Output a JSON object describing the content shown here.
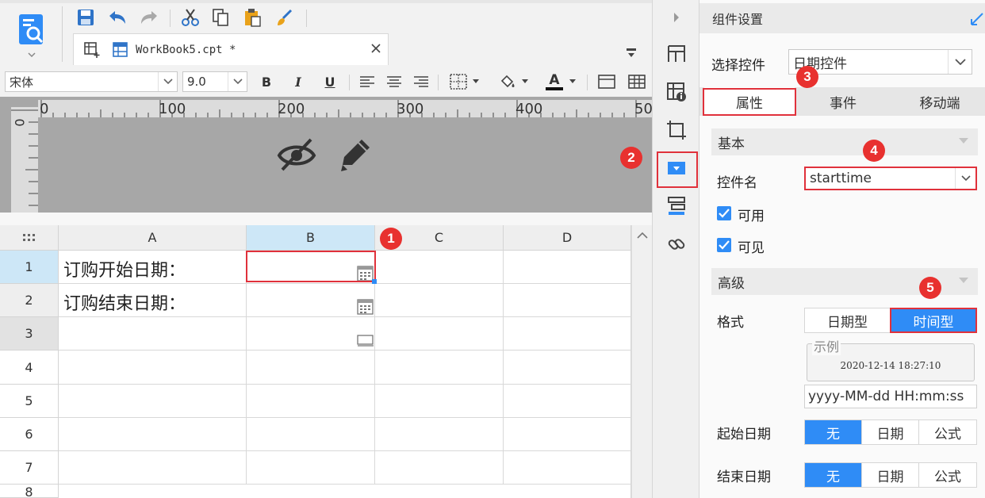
{
  "tab": {
    "title": "WorkBook5.cpt *"
  },
  "format_bar": {
    "font_name": "宋体",
    "font_size": "9.0",
    "bold": "B",
    "italic": "I",
    "underline": "U",
    "font_color_letter": "A"
  },
  "ruler": {
    "ticks": [
      "0",
      "100",
      "200",
      "300",
      "400",
      "50"
    ],
    "vertical_zero": "0"
  },
  "grid": {
    "columns": [
      "A",
      "B",
      "C",
      "D"
    ],
    "rows": [
      "1",
      "2",
      "3",
      "4",
      "5",
      "6",
      "7",
      "8"
    ],
    "cells": {
      "A1": "订购开始日期：",
      "A2": "订购结束日期："
    }
  },
  "panel": {
    "title": "组件设置",
    "select_label": "选择控件",
    "select_value": "日期控件",
    "tabs": [
      "属性",
      "事件",
      "移动端"
    ],
    "basic_section": "基本",
    "name_label": "控件名",
    "name_value": "starttime",
    "enabled_label": "可用",
    "visible_label": "可见",
    "advanced_section": "高级",
    "format_label": "格式",
    "format_options": [
      "日期型",
      "时间型"
    ],
    "sample_legend": "示例",
    "sample_value": "2020-12-14 18:27:10",
    "pattern_value": "yyyy-MM-dd HH:mm:ss",
    "start_date_label": "起始日期",
    "end_date_label": "结束日期",
    "date_options": [
      "无",
      "日期",
      "公式"
    ]
  },
  "badges": [
    "1",
    "2",
    "3",
    "4",
    "5"
  ],
  "colors": {
    "accent": "#2f8cf6",
    "highlight": "#e0313b",
    "badge": "#e8312f"
  }
}
